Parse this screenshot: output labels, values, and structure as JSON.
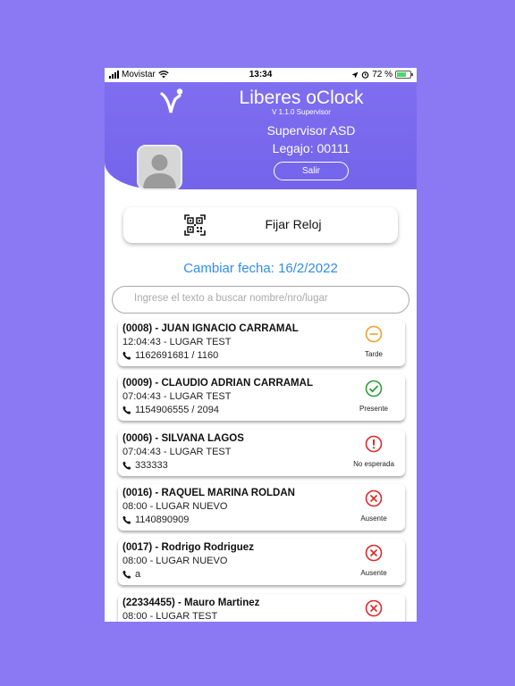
{
  "status_bar": {
    "carrier": "Movistar",
    "time": "13:34",
    "battery": "72 %",
    "battery_level": 0.72
  },
  "header": {
    "app_title": "Liberes oClock",
    "version": "V 1.1.0 Supervisor",
    "supervisor_name": "Supervisor ASD",
    "legajo": "Legajo: 00111",
    "salir_label": "Salir"
  },
  "fijar_reloj_label": "Fijar Reloj",
  "cambiar_fecha_label": "Cambiar fecha: 16/2/2022",
  "search": {
    "placeholder": "Ingrese el texto a buscar nombre/nro/lugar",
    "value": ""
  },
  "colors": {
    "accent": "#7f6ef0",
    "link": "#2f8cf0",
    "tarde": "#f0a030",
    "presente": "#2e9e3b",
    "no_esperada": "#dd2a2a",
    "ausente": "#dd2a2a"
  },
  "employees": [
    {
      "name": "(0008) - JUAN IGNACIO CARRAMAL",
      "time_place": "12:04:43 - LUGAR TEST",
      "phone": "1162691681 / 1160",
      "status": "Tarde",
      "icon": "minus-circle-icon"
    },
    {
      "name": "(0009) - CLAUDIO ADRIAN CARRAMAL",
      "time_place": "07:04:43 - LUGAR TEST",
      "phone": "1154906555 / 2094",
      "status": "Presente",
      "icon": "check-circle-icon"
    },
    {
      "name": "(0006) - SILVANA LAGOS",
      "time_place": "07:04:43 - LUGAR TEST",
      "phone": "333333",
      "status": "No esperada",
      "icon": "exclamation-circle-icon"
    },
    {
      "name": "(0016) - RAQUEL MARINA ROLDAN",
      "time_place": "08:00 - LUGAR NUEVO",
      "phone": "1140890909",
      "status": "Ausente",
      "icon": "x-circle-icon"
    },
    {
      "name": "(0017) - Rodrigo Rodriguez",
      "time_place": "08:00 - LUGAR NUEVO",
      "phone": "a",
      "status": "Ausente",
      "icon": "x-circle-icon"
    },
    {
      "name": "(22334455) - Mauro Martinez",
      "time_place": "08:00 - LUGAR TEST",
      "phone": "",
      "status": "",
      "icon": "x-circle-icon"
    }
  ]
}
